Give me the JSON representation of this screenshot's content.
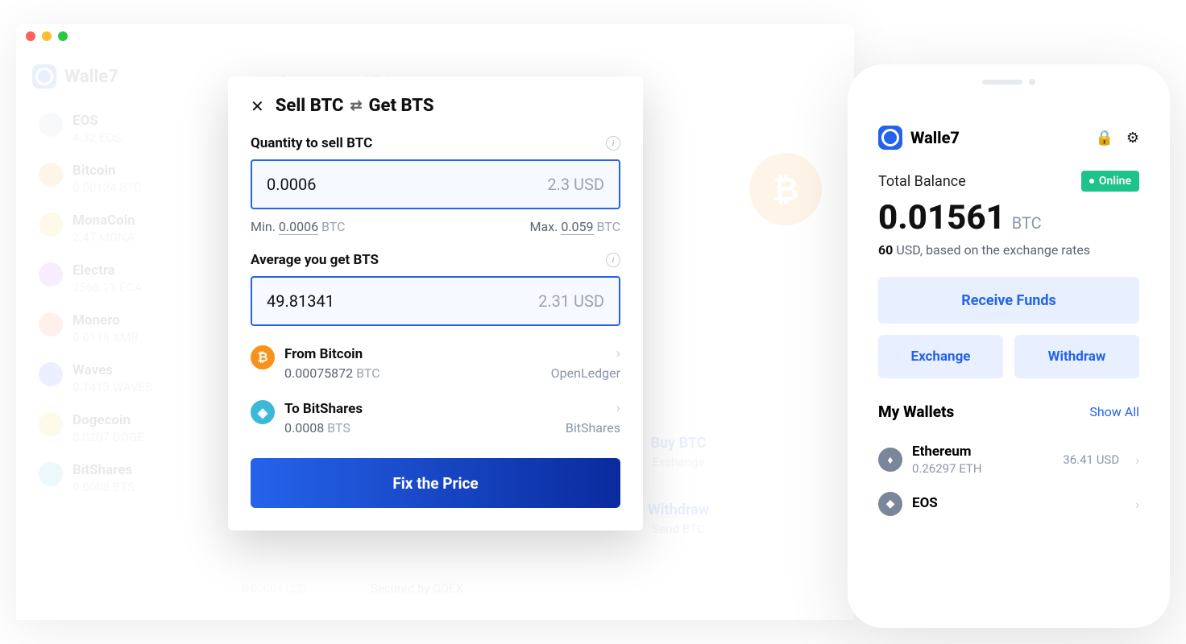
{
  "desktop": {
    "brand": "Walle7",
    "header_ticker": "BTC",
    "coins": [
      {
        "name": "EOS",
        "bal": "4.32",
        "unit": "EOS",
        "color": "#b8bfcb"
      },
      {
        "name": "Bitcoin",
        "bal": "0.00124",
        "unit": "BTC",
        "color": "#f7931a"
      },
      {
        "name": "MonaCoin",
        "bal": "2.47",
        "unit": "MONA",
        "color": "#f0c419"
      },
      {
        "name": "Electra",
        "bal": "2566.11",
        "unit": "ECA",
        "color": "#b74cff"
      },
      {
        "name": "Monero",
        "bal": "0.0118",
        "unit": "XMR",
        "color": "#ff6b35"
      },
      {
        "name": "Waves",
        "bal": "0.1413",
        "unit": "WAVES",
        "color": "#2e6cff"
      },
      {
        "name": "Dogecoin",
        "bal": "0.0207",
        "unit": "DOGE",
        "color": "#f0c419"
      },
      {
        "name": "BitShares",
        "bal": "0.0008",
        "unit": "BTS",
        "color": "#3db8d6"
      }
    ],
    "actions": {
      "buy_title": "Buy BTC",
      "buy_sub": "Exchange",
      "withdraw_title": "Withdraw",
      "withdraw_sub": "Send BTC"
    },
    "secured": "Secured by GDEX",
    "tiny_usd": "0.00004 USD"
  },
  "modal": {
    "title_sell": "Sell BTC",
    "title_get": "Get BTS",
    "qty_label": "Quantity to sell BTC",
    "qty_val": "0.0006",
    "qty_usd": "2.3 USD",
    "min_label": "Min.",
    "min_val": "0.0006",
    "min_unit": "BTC",
    "max_label": "Max.",
    "max_val": "0.059",
    "max_unit": "BTC",
    "avg_label": "Average you get BTS",
    "avg_val": "49.81341",
    "avg_usd": "2.31 USD",
    "from_title": "From Bitcoin",
    "from_bal": "0.00075872",
    "from_unit": "BTC",
    "from_ex": "OpenLedger",
    "to_title": "To BitShares",
    "to_bal": "0.0008",
    "to_unit": "BTS",
    "to_ex": "BitShares",
    "fix_btn": "Fix the Price"
  },
  "phone": {
    "brand": "Walle7",
    "total_label": "Total Balance",
    "online": "Online",
    "balance": "0.01561",
    "balance_unit": "BTC",
    "sub_bold": "60",
    "sub_rest": " USD, based on the exchange rates",
    "receive": "Receive Funds",
    "exchange": "Exchange",
    "withdraw": "Withdraw",
    "wallets_title": "My Wallets",
    "show_all": "Show All",
    "wallets": [
      {
        "name": "Ethereum",
        "bal": "0.26297",
        "unit": "ETH",
        "usd": "36.41 USD",
        "glyph": "♦"
      },
      {
        "name": "EOS",
        "bal": "",
        "unit": "",
        "usd": "",
        "glyph": "◆"
      }
    ]
  }
}
